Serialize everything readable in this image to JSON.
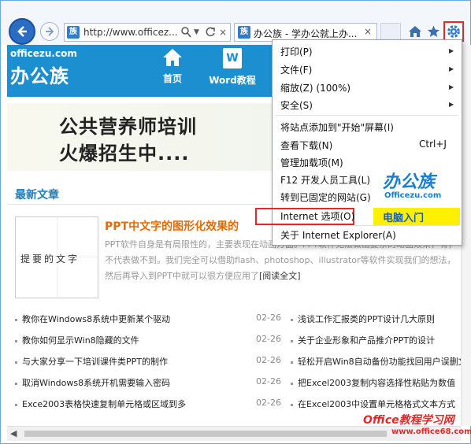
{
  "browser": {
    "address_url": "http://www.officez...",
    "favicon_text": "族",
    "tab_title": "办公族 - 学办公就上办...",
    "tab_close": "×",
    "stop_glyph": "×"
  },
  "site": {
    "logo_top": "officezu.com",
    "logo_main": "办公族",
    "nav": [
      {
        "label": "首页"
      },
      {
        "label": "Word教程",
        "icon_text": "W"
      }
    ],
    "banner_line1": "公共营养师培训",
    "banner_line2": "火爆招生中....",
    "section_title": "最新文章",
    "featured": {
      "thumb_text": "提要的文字",
      "title": "PPT中文字的图形化效果的",
      "summary": "PPT软件自身是有局限性的，主要表现在动画方面。PPT软件无法做出复杂的动画效果，有，不代表做不到。我们完全可以借助flash、photoshop、illustrator等软件实现我们的想法，然后再导入到PPT中就可以很方便应用了",
      "more": "[阅读全文]"
    },
    "articles": [
      {
        "left": "教你在Windows8系统中更新某个驱动",
        "date": "02-26",
        "right": "浅谈工作汇报类的PPT设计几大原则"
      },
      {
        "left": "教你如何显示Win8隐藏的文件",
        "date": "02-26",
        "right": "关于企业形象和产品推介PPT的设计"
      },
      {
        "left": "与大家分享一下培训课件类PPT的制作",
        "date": "02-26",
        "right": "轻松开启Win8自动备份功能找回用户误删文件"
      },
      {
        "left": "取消Windows8系统开机需要输入密码",
        "date": "02-26",
        "right": "把Excel2003复制内容选择性粘贴为数值"
      },
      {
        "left": "Exce2003表格快速复制单元格或区域到多",
        "date": "02-26",
        "right": "在Excel2003中设置单元格格式文本方式"
      }
    ]
  },
  "menu": {
    "items": [
      {
        "label": "打印(P)",
        "arrow": "▶"
      },
      {
        "label": "文件(F)",
        "arrow": "▶"
      },
      {
        "label": "缩放(Z) (100%)",
        "arrow": "▶"
      },
      {
        "label": "安全(S)",
        "arrow": "▶"
      },
      {
        "label": "将站点添加到\"开始\"屏幕(I)"
      },
      {
        "label": "查看下载(N)",
        "shortcut": "Ctrl+J"
      },
      {
        "label": "管理加载项(M)"
      },
      {
        "label": "F12 开发人员工具(L)"
      },
      {
        "label": "转到已固定的网站(G)"
      },
      {
        "label": "Internet 选项(O)"
      },
      {
        "label": "关于 Internet Explorer(A)"
      }
    ]
  },
  "watermarks": {
    "menu_logo": "办公族",
    "menu_site": "Officezu.com",
    "ribbon": "电脑入门",
    "corner_title": "Office教程学习网",
    "corner_url": "www.office68.com"
  },
  "colors": {
    "accent": "#1b8fd0",
    "highlight": "#e02a2a",
    "article_title": "#e36c09"
  }
}
